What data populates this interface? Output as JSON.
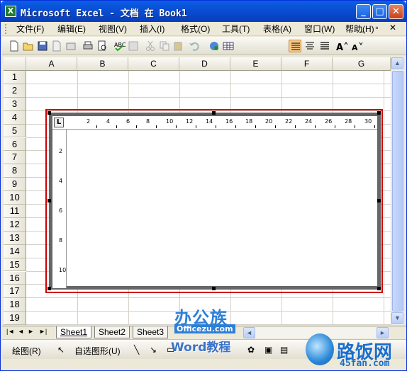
{
  "window": {
    "title": "Microsoft Excel - 文档 在 Book1",
    "icon_text": "X"
  },
  "title_buttons": {
    "minimize": "_",
    "maximize": "□",
    "close": "✕"
  },
  "menus": [
    "文件(F)",
    "编辑(E)",
    "视图(V)",
    "插入(I)",
    "格式(O)",
    "工具(T)",
    "表格(A)",
    "窗口(W)",
    "帮助(H)"
  ],
  "mdi_controls": "_ ▫ ✕",
  "toolbar": {
    "icons": [
      "new-icon",
      "open-icon",
      "save-icon",
      "permission-icon",
      "email-icon",
      "print-icon",
      "print-preview-icon",
      "spelling-icon",
      "research-icon",
      "cut-icon",
      "copy-icon",
      "paste-icon",
      "undo-icon",
      "hyperlink-icon",
      "table-icon",
      "align-left-icon",
      "center-icon",
      "justify-icon",
      "grow-font-icon",
      "shrink-font-icon"
    ]
  },
  "columns": [
    "A",
    "B",
    "C",
    "D",
    "E",
    "F",
    "G"
  ],
  "rows": [
    "1",
    "2",
    "3",
    "4",
    "5",
    "6",
    "7",
    "8",
    "9",
    "10",
    "11",
    "12",
    "13",
    "14",
    "15",
    "16",
    "17",
    "18",
    "19"
  ],
  "ruler": {
    "horizontal": [
      "2",
      "4",
      "6",
      "8",
      "10",
      "12",
      "14",
      "16",
      "18",
      "20",
      "22",
      "24",
      "26",
      "28",
      "30"
    ],
    "vertical": [
      "2",
      "4",
      "6",
      "8",
      "10"
    ],
    "tab_stop": "L"
  },
  "sheet_tabs": [
    "Sheet1",
    "Sheet2",
    "Sheet3"
  ],
  "sheet_nav": [
    "|◄",
    "◄",
    "►",
    "►|"
  ],
  "drawing_toolbar": {
    "draw_label": "绘图(R)",
    "autoshapes_label": "自选图形(U)"
  },
  "watermarks": {
    "left_title": "办公族",
    "left_url": "Officezu.com",
    "center": "Word教程",
    "right_title": "路饭网",
    "right_url": "45fan.com"
  }
}
